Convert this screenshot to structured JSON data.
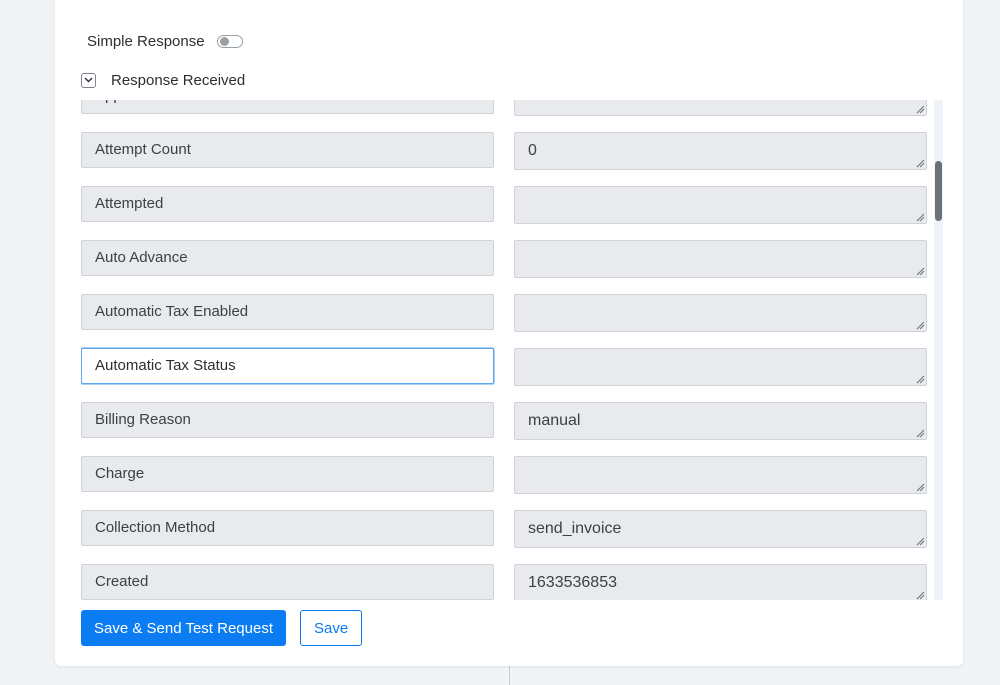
{
  "simple_response": {
    "label": "Simple Response",
    "enabled": false
  },
  "response_received": {
    "label": "Response Received",
    "expanded": true,
    "icon": "chevron-down-icon"
  },
  "response_rows": [
    {
      "key": "Application Fee Amount",
      "value": ""
    },
    {
      "key": "Attempt Count",
      "value": "0"
    },
    {
      "key": "Attempted",
      "value": ""
    },
    {
      "key": "Auto Advance",
      "value": ""
    },
    {
      "key": "Automatic Tax Enabled",
      "value": ""
    },
    {
      "key": "Automatic Tax Status",
      "value": "",
      "focused": true
    },
    {
      "key": "Billing Reason",
      "value": "manual"
    },
    {
      "key": "Charge",
      "value": ""
    },
    {
      "key": "Collection Method",
      "value": "send_invoice"
    },
    {
      "key": "Created",
      "value": "1633536853"
    }
  ],
  "buttons": {
    "save_and_send": "Save & Send Test Request",
    "save": "Save"
  },
  "colors": {
    "primary": "#0b7cf2",
    "focus_border": "#5aa6f0",
    "field_bg": "#e8eaed",
    "page_bg": "#f1f4f7"
  }
}
